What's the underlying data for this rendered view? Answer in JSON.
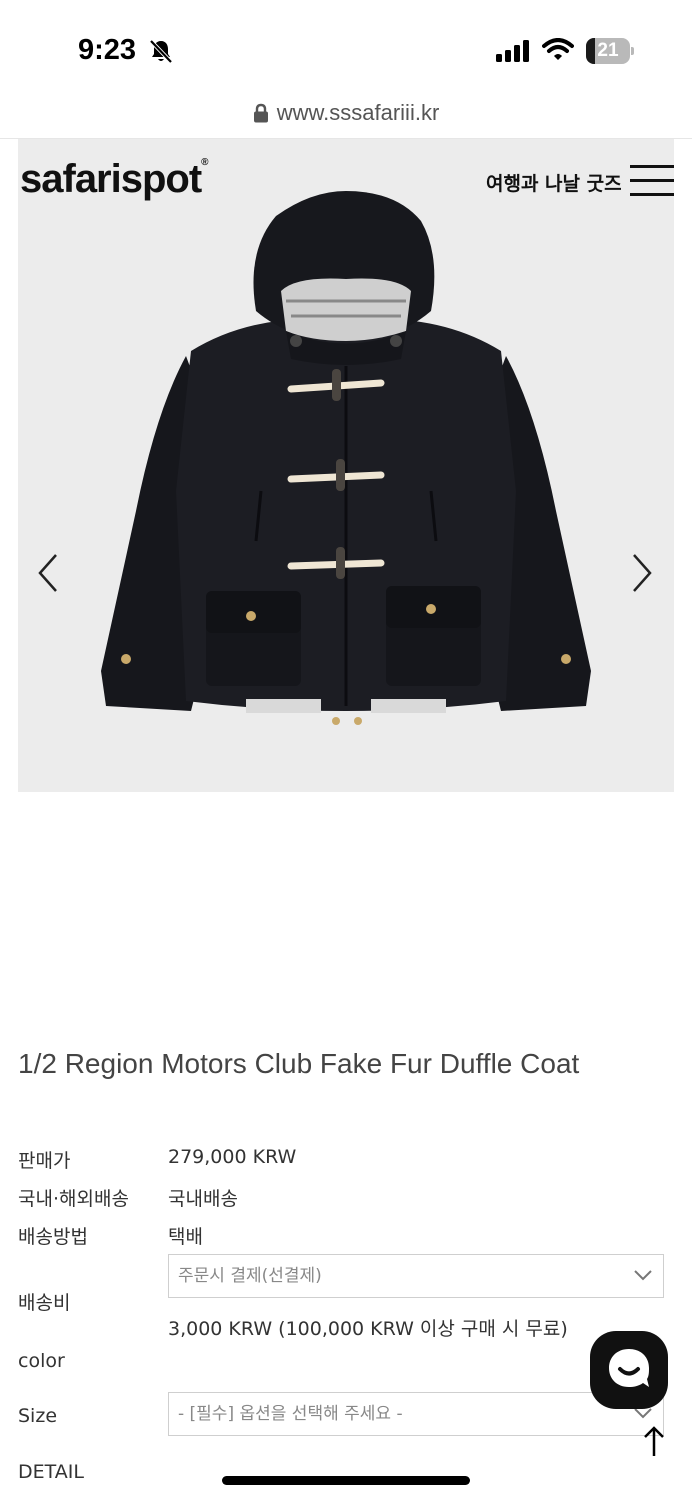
{
  "status_bar": {
    "time": "9:23",
    "battery": "21",
    "battery_level": 0.21
  },
  "browser": {
    "url": "www.sssafariii.kr"
  },
  "header": {
    "logo": "safarispot",
    "tagline": "여행과 나날 굿즈"
  },
  "product": {
    "name": "1/2 Region Motors Club Fake Fur Duffle Coat"
  },
  "details": {
    "price_label": "판매가",
    "price_value": "279,000 KRW",
    "shipping_region_label": "국내·해외배송",
    "shipping_region_value": "국내배송",
    "shipping_method_label": "배송방법",
    "shipping_method_value": "택배",
    "shipping_fee_label": "배송비",
    "shipping_fee_select": "주문시 결제(선결제)",
    "shipping_fee_note": "3,000 KRW (100,000 KRW 이상 구매 시 무료)",
    "color_label": "color",
    "size_label": "Size",
    "size_placeholder": "- [필수] 옵션을 선택해 주세요 -",
    "detail_label": "DETAIL"
  }
}
